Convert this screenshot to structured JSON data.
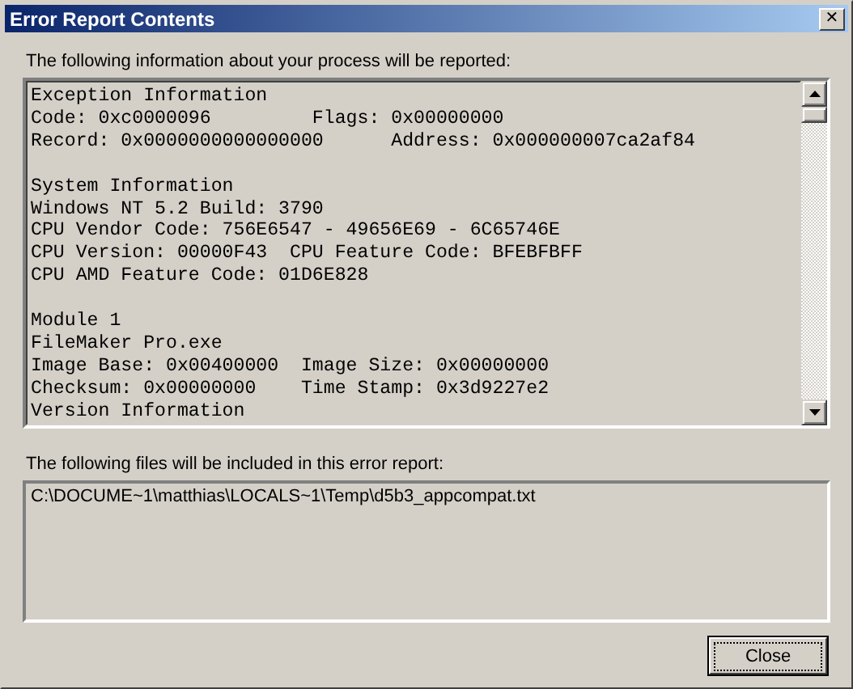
{
  "window": {
    "title": "Error Report Contents",
    "close_glyph": "✕"
  },
  "report": {
    "label": "The following information about your process will be reported:",
    "blocks": [
      {
        "lines": [
          "Exception Information",
          "Code: 0xc0000096         Flags: 0x00000000",
          "Record: 0x0000000000000000      Address: 0x000000007ca2af84"
        ]
      },
      {
        "lines": [
          "System Information",
          "Windows NT 5.2 Build: 3790",
          "CPU Vendor Code: 756E6547 - 49656E69 - 6C65746E",
          "CPU Version: 00000F43  CPU Feature Code: BFEBFBFF",
          "CPU AMD Feature Code: 01D6E828"
        ]
      },
      {
        "lines": [
          "Module 1",
          "FileMaker Pro.exe",
          "Image Base: 0x00400000  Image Size: 0x00000000",
          "Checksum: 0x00000000    Time Stamp: 0x3d9227e2",
          "Version Information"
        ]
      }
    ]
  },
  "files": {
    "label": "The following files will be included in this error report:",
    "items": [
      "C:\\DOCUME~1\\matthias\\LOCALS~1\\Temp\\d5b3_appcompat.txt"
    ]
  },
  "buttons": [
    {
      "label": "Close",
      "focused": true
    }
  ]
}
